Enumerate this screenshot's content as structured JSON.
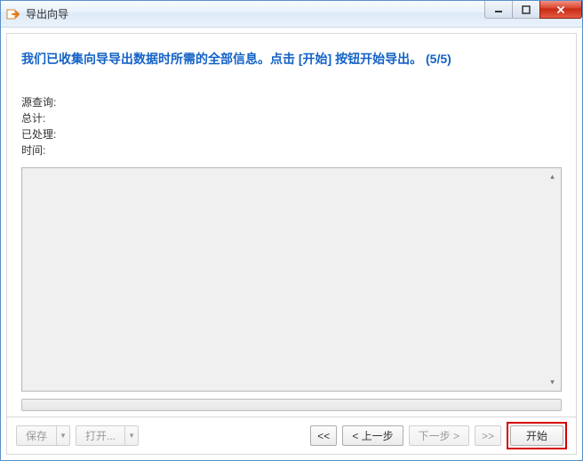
{
  "title": "导出向导",
  "header_message": "我们已收集向导导出数据时所需的全部信息。点击 [开始] 按钮开始导出。  (5/5)",
  "info": {
    "source_query_label": "源查询:",
    "source_query_value": "",
    "total_label": "总计:",
    "total_value": "",
    "processed_label": "已处理:",
    "processed_value": "",
    "time_label": "时间:",
    "time_value": ""
  },
  "log_text": "",
  "footer": {
    "save_label": "保存",
    "open_label": "打开...",
    "first_label": "<<",
    "prev_label": "< 上一步",
    "next_label": "下一步 >",
    "last_label": ">>",
    "start_label": "开始"
  }
}
